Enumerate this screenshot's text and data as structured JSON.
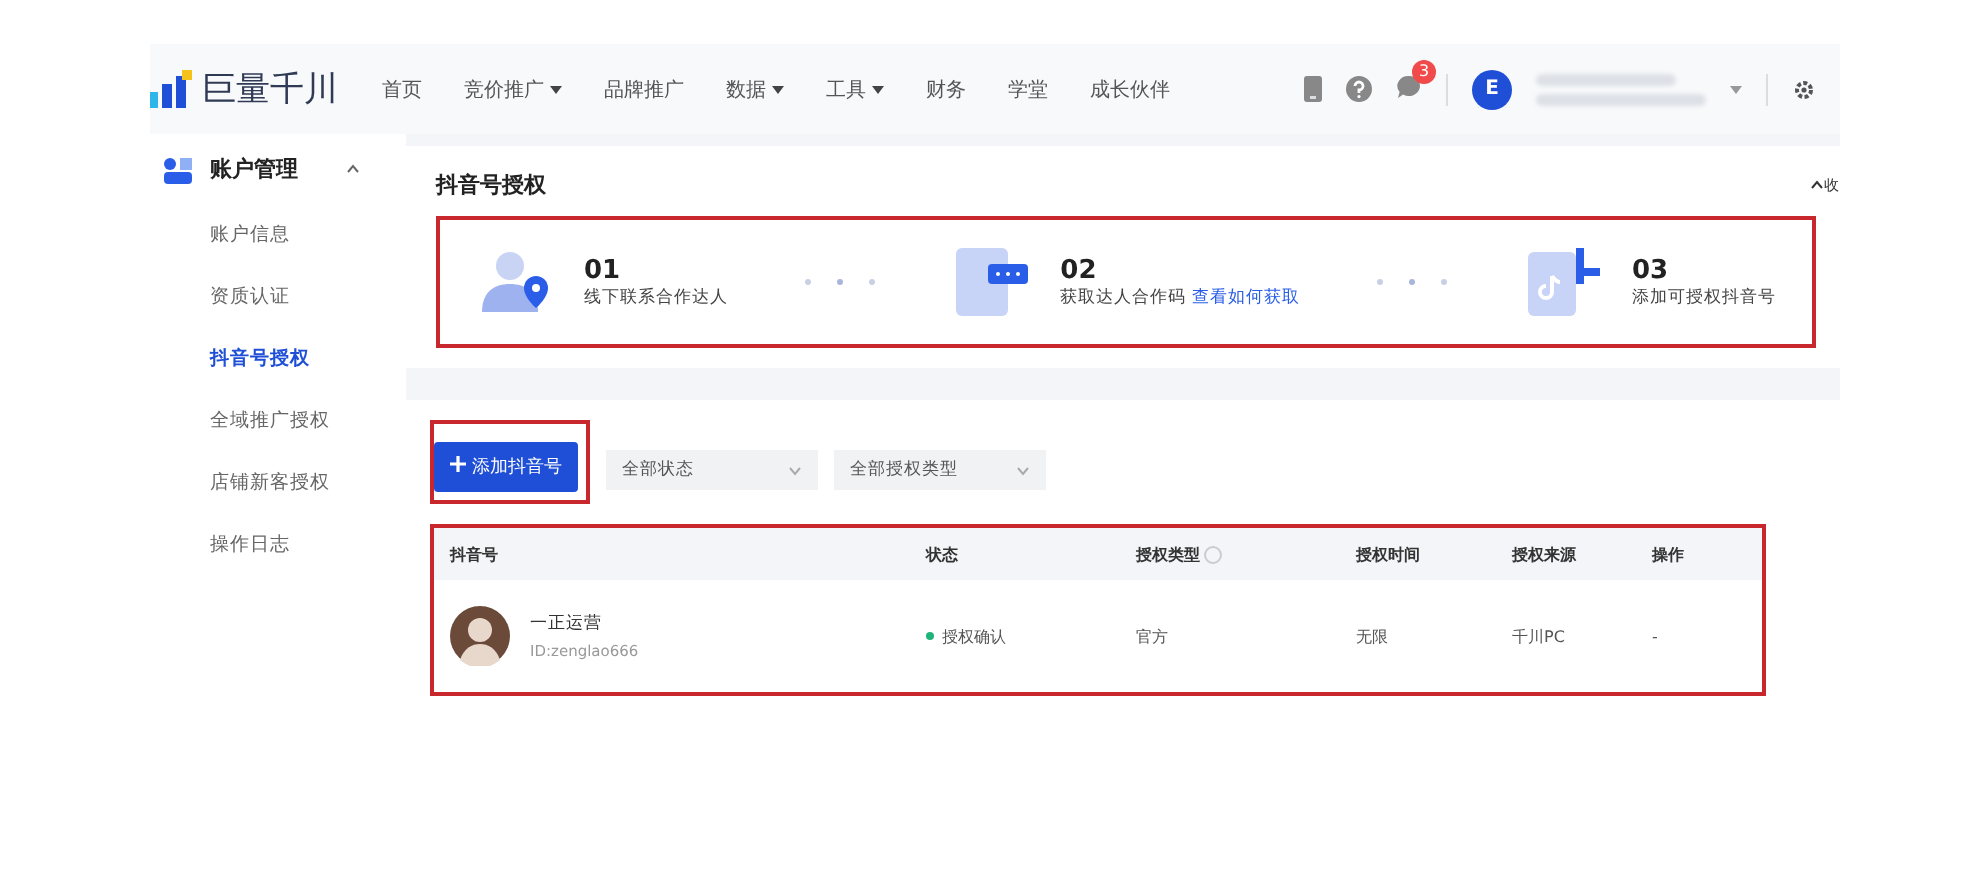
{
  "brand": {
    "name": "巨量千川"
  },
  "nav": [
    {
      "label": "首页",
      "dropdown": false
    },
    {
      "label": "竞价推广",
      "dropdown": true
    },
    {
      "label": "品牌推广",
      "dropdown": false
    },
    {
      "label": "数据",
      "dropdown": true
    },
    {
      "label": "工具",
      "dropdown": true
    },
    {
      "label": "财务",
      "dropdown": false
    },
    {
      "label": "学堂",
      "dropdown": false
    },
    {
      "label": "成长伙伴",
      "dropdown": false
    }
  ],
  "header": {
    "notification_count": "3",
    "avatar_letter": "E"
  },
  "sidebar": {
    "group": {
      "label": "账户管理",
      "expanded": true
    },
    "items": [
      {
        "label": "账户信息",
        "selected": false
      },
      {
        "label": "资质认证",
        "selected": false
      },
      {
        "label": "抖音号授权",
        "selected": true
      },
      {
        "label": "全域推广授权",
        "selected": false
      },
      {
        "label": "店铺新客授权",
        "selected": false
      },
      {
        "label": "操作日志",
        "selected": false
      }
    ]
  },
  "page": {
    "title": "抖音号授权",
    "collapse": "收"
  },
  "steps": [
    {
      "number": "01",
      "text": "线下联系合作达人",
      "kind": "person"
    },
    {
      "number": "02",
      "text": "获取达人合作码",
      "link": "查看如何获取",
      "kind": "card"
    },
    {
      "number": "03",
      "text": "添加可授权抖音号",
      "kind": "tiktok"
    }
  ],
  "toolbar": {
    "add_button": "添加抖音号",
    "filters": [
      "全部状态",
      "全部授权类型"
    ]
  },
  "table": {
    "columns": [
      "抖音号",
      "状态",
      "授权类型",
      "授权时间",
      "授权来源",
      "操作"
    ],
    "rows": [
      {
        "name": "一正运营",
        "id": "ID:zenglao666",
        "status": "授权确认",
        "color": "#1fb57a",
        "type": "官方",
        "time": "无限",
        "source": "千川PC",
        "action": "-"
      }
    ]
  }
}
